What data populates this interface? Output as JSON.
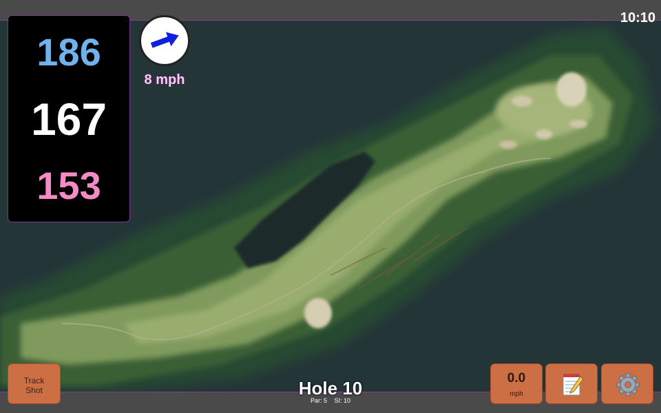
{
  "status_bar": {
    "time": "10:10"
  },
  "distances": {
    "back": "186",
    "middle": "167",
    "front": "153"
  },
  "wind": {
    "speed": "8 mph",
    "direction_icon": "wind-arrow-icon",
    "direction_degrees": 70
  },
  "hole": {
    "title": "Hole 10",
    "par": "Par: 5",
    "stroke_index": "SI: 10"
  },
  "buttons": {
    "track_shot_line1": "Track",
    "track_shot_line2": "Shot",
    "speed_value": "0.0",
    "speed_unit": "mph",
    "notes_icon": "notepad-icon",
    "settings_icon": "gear-icon"
  },
  "colors": {
    "back_distance": "#6fb3ee",
    "middle_distance": "#ffffff",
    "front_distance": "#f48bc7",
    "button": "#cd6f44",
    "water": "#243538"
  }
}
